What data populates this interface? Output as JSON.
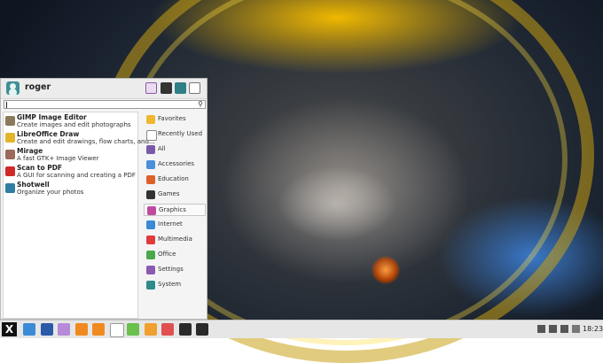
{
  "user": {
    "name": "roger"
  },
  "header_buttons": [
    "settings-icon",
    "lock-icon",
    "user-switch-icon",
    "logout-icon"
  ],
  "search": {
    "value": "",
    "placeholder": ""
  },
  "apps": [
    {
      "name": "GIMP Image Editor",
      "desc": "Create images and edit photographs",
      "icon": "gimp-icon",
      "color": "#8a7a5c"
    },
    {
      "name": "LibreOffice Draw",
      "desc": "Create and edit drawings, flow charts, and...",
      "icon": "libreoffice-draw-icon",
      "color": "#e3b52b"
    },
    {
      "name": "Mirage",
      "desc": "A fast GTK+ Image Viewer",
      "icon": "mirage-icon",
      "color": "#9a6a5a"
    },
    {
      "name": "Scan to PDF",
      "desc": "A GUI for scanning and creating a PDF",
      "icon": "scan-pdf-icon",
      "color": "#d02828"
    },
    {
      "name": "Shotwell",
      "desc": "Organize your photos",
      "icon": "shotwell-icon",
      "color": "#2d7ea0"
    }
  ],
  "categories": [
    {
      "label": "Favorites",
      "icon": "star-icon",
      "color": "#f0b730"
    },
    {
      "label": "Recently Used",
      "icon": "clock-icon",
      "color": "#ffffff"
    },
    {
      "label": "All",
      "icon": "grid-icon",
      "color": "#7a5aa8"
    },
    {
      "label": "Accessories",
      "icon": "accessories-icon",
      "color": "#4a90d9"
    },
    {
      "label": "Education",
      "icon": "education-icon",
      "color": "#e0602a"
    },
    {
      "label": "Games",
      "icon": "games-icon",
      "color": "#333333"
    },
    {
      "label": "Graphics",
      "icon": "graphics-icon",
      "color": "#c04aa0",
      "selected": true
    },
    {
      "label": "Internet",
      "icon": "internet-icon",
      "color": "#3a8ad8"
    },
    {
      "label": "Multimedia",
      "icon": "multimedia-icon",
      "color": "#e03a3a"
    },
    {
      "label": "Office",
      "icon": "office-icon",
      "color": "#4aa84a"
    },
    {
      "label": "Settings",
      "icon": "settings-icon",
      "color": "#8a5ab0"
    },
    {
      "label": "System",
      "icon": "system-icon",
      "color": "#2f8a8a"
    }
  ],
  "taskbar": {
    "start_label": "X",
    "launchers": [
      {
        "icon": "file-manager-icon",
        "color": "#3a8ad8"
      },
      {
        "icon": "screenshot-icon",
        "color": "#2a5aa8"
      },
      {
        "icon": "folder-icon",
        "color": "#b58ad8"
      },
      {
        "icon": "firefox-icon",
        "color": "#f08a20"
      },
      {
        "icon": "media-player-icon",
        "color": "#f08a20"
      },
      {
        "icon": "text-document-icon",
        "color": "#ffffff"
      },
      {
        "icon": "spreadsheet-icon",
        "color": "#6ac04a"
      },
      {
        "icon": "presentation-icon",
        "color": "#f0a030"
      },
      {
        "icon": "graphics-app-icon",
        "color": "#e05050"
      },
      {
        "icon": "system-monitor-icon",
        "color": "#2a2a2a"
      },
      {
        "icon": "terminal-icon",
        "color": "#2a2a2a"
      }
    ],
    "tray": [
      "network-icon",
      "volume-icon",
      "battery-icon",
      "notification-icon"
    ],
    "clock": "18:23"
  }
}
